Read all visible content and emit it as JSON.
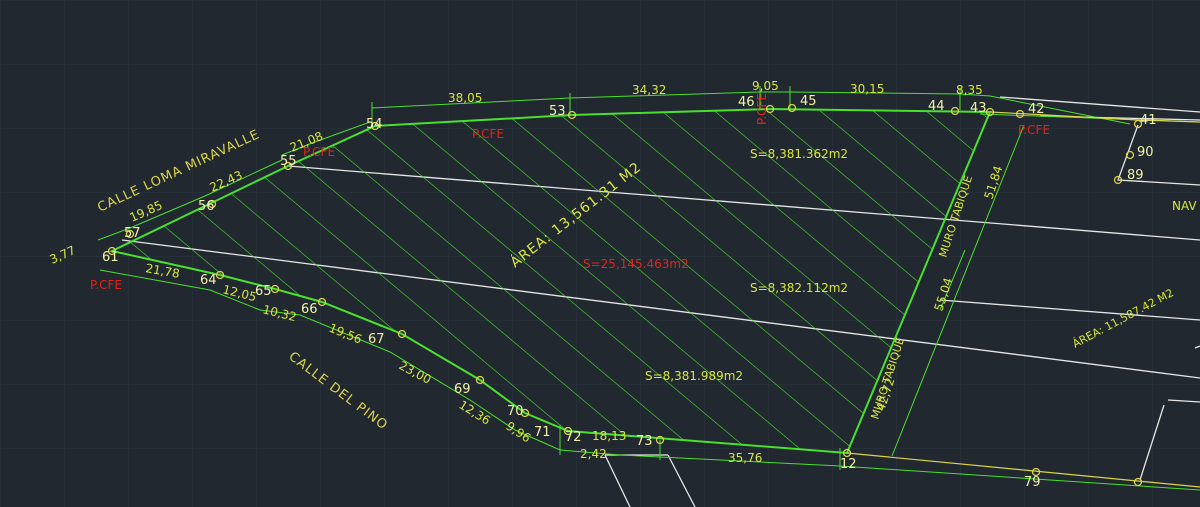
{
  "drawing": {
    "colors": {
      "background": "#212830",
      "lot": "#4ae12e",
      "dimension": "#d8e640",
      "label": "#dcd44a",
      "vertex": "#f2f2a8",
      "cfe": "#e0241c",
      "divider": "#e6e6e6"
    },
    "streets": {
      "loma": "CALLE LOMA MIRAVALLE",
      "pino": "CALLE DEL PINO"
    },
    "area_main": "ÁREA: 13,561.31 M2",
    "area_total": "S=25,145.463m2",
    "area_neighbor": "ÁREA: 11,587.42 M2",
    "partial_areas": [
      "S=8,381.362m2",
      "S=8,382.112m2",
      "S=8,381.989m2"
    ],
    "walls": [
      "MURO TABIQUE",
      "MURO TABIQUE"
    ],
    "cfe_label": "P.CFE",
    "vertices": [
      "54",
      "53",
      "46",
      "45",
      "44",
      "43",
      "42",
      "41",
      "90",
      "89",
      "55",
      "56",
      "57",
      "61",
      "64",
      "65",
      "66",
      "67",
      "69",
      "70",
      "71",
      "72",
      "73",
      "12",
      "79"
    ],
    "dimensions": [
      "38,05",
      "34,32",
      "9,05",
      "30,15",
      "8,35",
      "21,08",
      "22,43",
      "19,85",
      "3,77",
      "21,78",
      "12,05",
      "10,32",
      "19,56",
      "23,00",
      "12,36",
      "9,96",
      "18,13",
      "2,42",
      "35,76",
      "51,84",
      "55,04",
      "42,72"
    ],
    "neighbor_text": "NAV"
  }
}
